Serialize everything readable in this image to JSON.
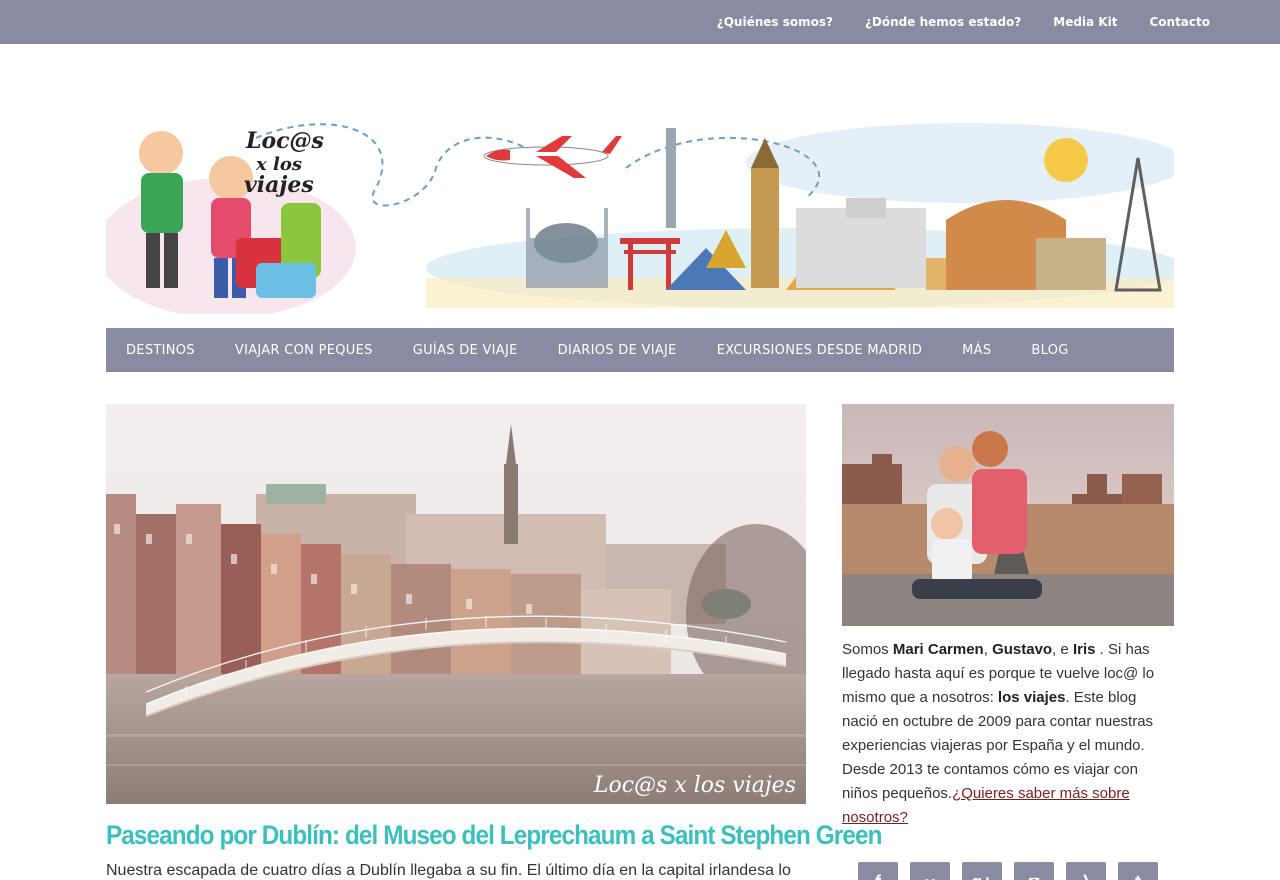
{
  "topnav": {
    "items": [
      {
        "label": "¿Quiénes somos?"
      },
      {
        "label": "¿Dónde hemos estado?"
      },
      {
        "label": "Media Kit"
      },
      {
        "label": "Contacto"
      }
    ]
  },
  "logo": {
    "text_line1": "Loc@s",
    "text_line2": "x los",
    "text_line3": "viajes"
  },
  "mainnav": {
    "items": [
      {
        "label": "DESTINOS"
      },
      {
        "label": "VIAJAR CON PEQUES"
      },
      {
        "label": "GUÍAS DE VIAJE"
      },
      {
        "label": "DIARIOS DE VIAJE"
      },
      {
        "label": "EXCURSIONES DESDE MADRID"
      },
      {
        "label": "MÁS"
      },
      {
        "label": "BLOG"
      }
    ]
  },
  "post": {
    "watermark": "Loc@s x los viajes",
    "title": "Paseando por Dublín: del Museo del Leprechaum a Saint Stephen Green",
    "excerpt": "Nuestra escapada de cuatro días a Dublín llegaba a su fin. El último día en la capital irlandesa lo"
  },
  "about": {
    "p1": "Somos ",
    "name1": "Mari Carmen",
    "sep1": ", ",
    "name2": "Gustavo",
    "sep2": ", e ",
    "name3": "Iris",
    "p2": " . Si has llegado hasta aquí es porque te vuelve loc@ lo mismo que a nosotros: ",
    "bold2": "los viajes",
    "p3": ". Este blog nació en octubre de 2009 para contar nuestras experiencias viajeras por España y el mundo. Desde 2013 te contamos cómo es viajar con niños pequeños.",
    "link": "¿Quieres saber más sobre nosotros?"
  },
  "social": {
    "icons": [
      {
        "name": "facebook-icon",
        "glyph": "f"
      },
      {
        "name": "flickr-icon",
        "glyph": "••"
      },
      {
        "name": "googleplus-icon",
        "glyph": "g+"
      },
      {
        "name": "instagram-icon",
        "glyph": "◘"
      },
      {
        "name": "rss-icon",
        "glyph": ")"
      },
      {
        "name": "twitter-icon",
        "glyph": "t"
      }
    ]
  },
  "colors": {
    "accent": "#888ba2",
    "title": "#3bbfbf",
    "link": "#7a1f1f"
  }
}
